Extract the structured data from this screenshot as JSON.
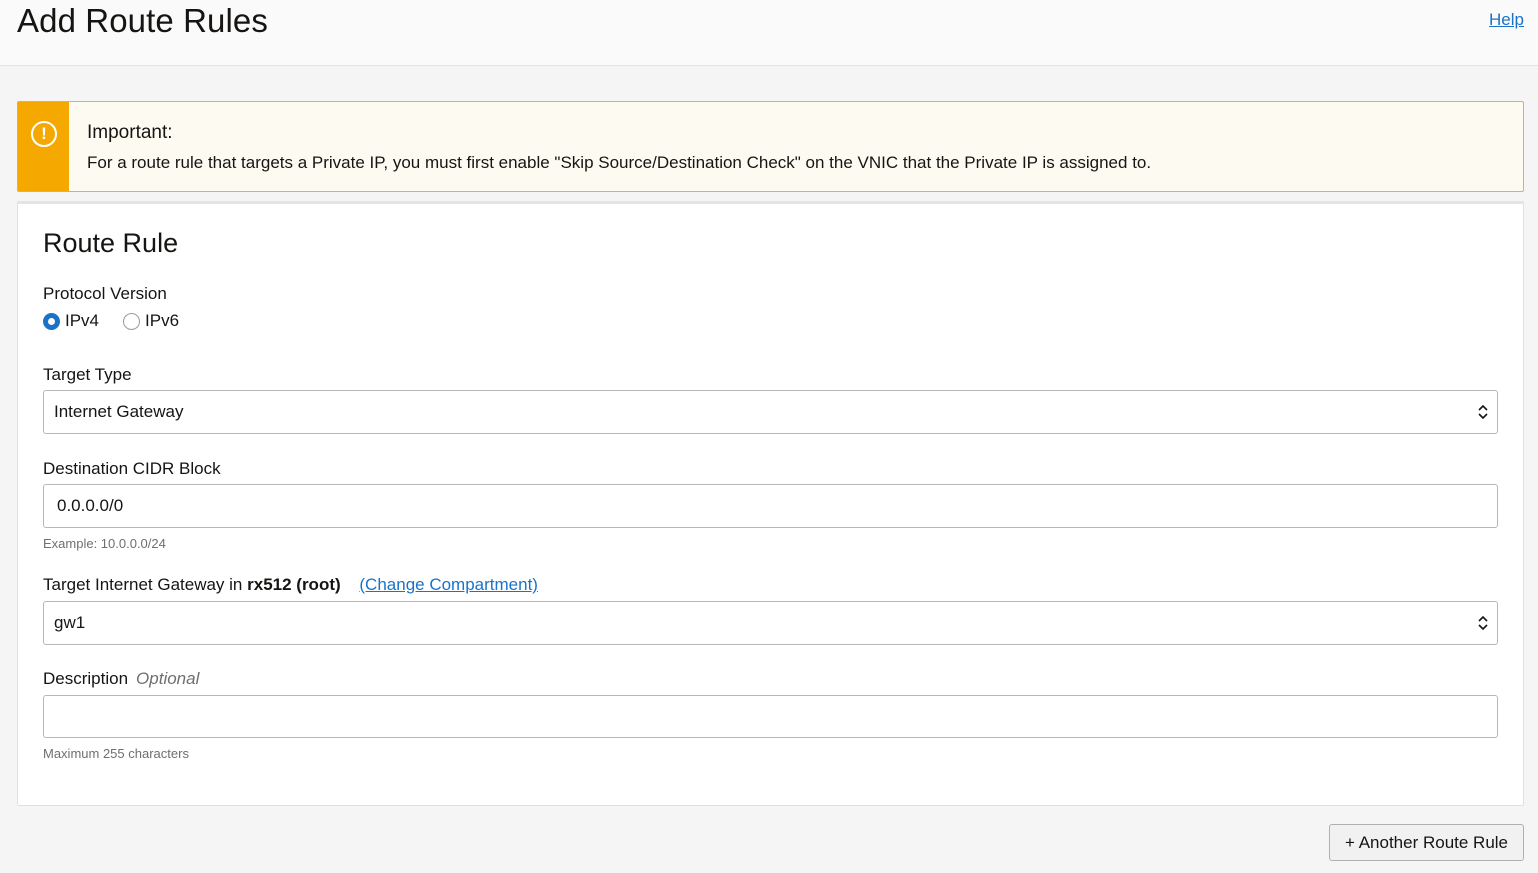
{
  "header": {
    "title": "Add Route Rules",
    "help_label": "Help"
  },
  "alert": {
    "icon": "warning-circle-icon",
    "title": "Important:",
    "message": "For a route rule that targets a Private IP, you must first enable \"Skip Source/Destination Check\" on the VNIC that the Private IP is assigned to.",
    "accent_color": "#f5a800"
  },
  "route_rule": {
    "title": "Route Rule",
    "protocol": {
      "label": "Protocol Version",
      "options": [
        {
          "label": "IPv4",
          "checked": true
        },
        {
          "label": "IPv6",
          "checked": false
        }
      ]
    },
    "target_type": {
      "label": "Target Type",
      "value": "Internet Gateway"
    },
    "destination": {
      "label": "Destination CIDR Block",
      "value": "0.0.0.0/0",
      "hint": "Example: 10.0.0.0/24"
    },
    "target_gateway": {
      "label_prefix": "Target Internet Gateway in",
      "compartment": "rx512 (root)",
      "change_link": "(Change Compartment)",
      "value": "gw1"
    },
    "description": {
      "label": "Description",
      "optional": "Optional",
      "value": "",
      "hint": "Maximum 255 characters"
    }
  },
  "actions": {
    "add_another_label": "+ Another Route Rule"
  },
  "colors": {
    "link": "#1a73c8",
    "radio_selected": "#1a73c8",
    "warning": "#f5a800"
  }
}
